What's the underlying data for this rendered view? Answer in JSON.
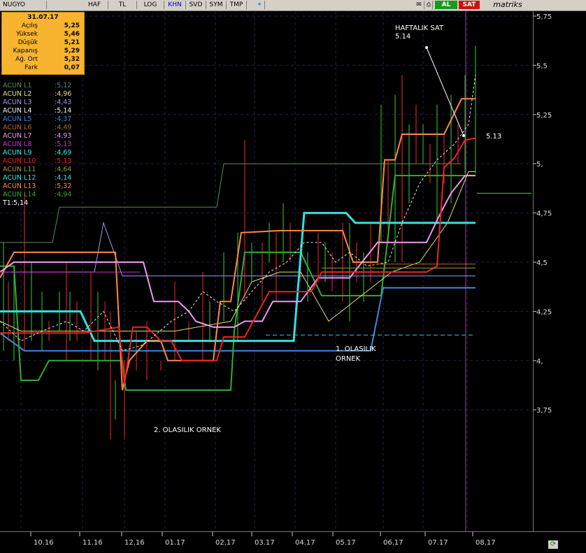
{
  "toolbar": {
    "symbol": "NUGYO",
    "tabs": [
      "HAF",
      "TL",
      "LOG",
      "KHN",
      "SVD",
      "SYM",
      "TMP"
    ],
    "buy_label": "AL",
    "sell_label": "SAT",
    "brand": "matriks"
  },
  "infobox": {
    "date": "31.07.17",
    "rows": [
      {
        "label": "Açılış",
        "value": "5,25"
      },
      {
        "label": "Yüksek",
        "value": "5,46"
      },
      {
        "label": "Düşük",
        "value": "5,21"
      },
      {
        "label": "Kapanış",
        "value": "5,29"
      },
      {
        "label": "Ağ. Ort",
        "value": "5,32"
      },
      {
        "label": "Fark",
        "value": "0,07"
      }
    ]
  },
  "chart_data": {
    "type": "line",
    "ylim": [
      3.5,
      5.8
    ],
    "y_ticks": [
      {
        "value": 5.75,
        "label": "5,75"
      },
      {
        "value": 5.5,
        "label": "5,5"
      },
      {
        "value": 5.25,
        "label": "5,25"
      },
      {
        "value": 5.0,
        "label": "5,"
      },
      {
        "value": 4.75,
        "label": "4,75"
      },
      {
        "value": 4.5,
        "label": "4,5"
      },
      {
        "value": 4.25,
        "label": "4,25"
      },
      {
        "value": 4.0,
        "label": "4,"
      },
      {
        "value": 3.75,
        "label": "3,75"
      }
    ],
    "x_ticks": [
      "10.16",
      "11.16",
      "12.16",
      "01.17",
      "02.17",
      "03.17",
      "04.17",
      "05.17",
      "06.17",
      "07.17",
      "08.17"
    ],
    "legend": [
      {
        "name": "ACUN L1",
        "value": ":5,12",
        "color": "#5a8a5a"
      },
      {
        "name": "ACUN L2",
        "value": ":4,96",
        "color": "#e0e070"
      },
      {
        "name": "ACUN L3",
        "value": ":4,43",
        "color": "#9a9aee"
      },
      {
        "name": "ACUN L4",
        "value": ":5,14",
        "color": "#f0f0f0"
      },
      {
        "name": "ACUN L5",
        "value": ":4,37",
        "color": "#3a8ae0"
      },
      {
        "name": "ACUN L6",
        "value": ":4,49",
        "color": "#b06a2a"
      },
      {
        "name": "ACUN L7",
        "value": ":4,93",
        "color": "#ee99ee"
      },
      {
        "name": "ACUN L8",
        "value": ":5,13",
        "color": "#cc33cc"
      },
      {
        "name": "ACUN L9",
        "value": ":4,69",
        "color": "#33eeee"
      },
      {
        "name": "ACUN L10",
        "value": ":5,13",
        "color": "#ee2222"
      },
      {
        "name": "ACUN L11",
        "value": ":4,64",
        "color": "#9a9a33"
      },
      {
        "name": "ACUN L12",
        "value": ":4,14",
        "color": "#33e0e0"
      },
      {
        "name": "ACUN L13",
        "value": ":5,32",
        "color": "#ff8844"
      },
      {
        "name": "ACUN L14",
        "value": ":4,94",
        "color": "#33aa33"
      }
    ],
    "t1_label": "T1:5,14",
    "annotations": {
      "weekly_sell": "HAFTALIK SAT",
      "weekly_sell_value": "5.14",
      "right_value": "5.13",
      "option1_line1": "1. OLASILIK",
      "option1_line2": "ORNEK",
      "option2": "2. OLASILIK ORNEK"
    },
    "series": [
      {
        "key": "L1",
        "color": "#5a8a5a",
        "width": 1,
        "points": [
          [
            0,
            4.6
          ],
          [
            75,
            4.6
          ],
          [
            85,
            4.78
          ],
          [
            310,
            4.78
          ],
          [
            320,
            5.0
          ],
          [
            380,
            5.0
          ],
          [
            385,
            5.0
          ],
          [
            660,
            5.0
          ]
        ]
      },
      {
        "key": "L3",
        "color": "#9a9aee",
        "width": 1,
        "points": [
          [
            0,
            4.45
          ],
          [
            135,
            4.45
          ],
          [
            148,
            4.7
          ],
          [
            175,
            4.43
          ],
          [
            680,
            4.43
          ]
        ]
      },
      {
        "key": "L5",
        "color": "#3a8ae0",
        "width": 2,
        "points": [
          [
            0,
            4.14
          ],
          [
            35,
            4.05
          ],
          [
            120,
            4.05
          ],
          [
            350,
            4.05
          ],
          [
            530,
            4.05
          ],
          [
            548,
            4.37
          ],
          [
            680,
            4.37
          ]
        ]
      },
      {
        "key": "L14",
        "color": "#33aa33",
        "width": 2,
        "points": [
          [
            0,
            4.48
          ],
          [
            20,
            4.48
          ],
          [
            30,
            3.9
          ],
          [
            55,
            3.9
          ],
          [
            70,
            4.0
          ],
          [
            175,
            4.0
          ],
          [
            180,
            3.85
          ],
          [
            330,
            3.85
          ],
          [
            335,
            4.15
          ],
          [
            350,
            4.55
          ],
          [
            430,
            4.55
          ],
          [
            460,
            4.33
          ],
          [
            500,
            4.33
          ],
          [
            545,
            4.33
          ],
          [
            565,
            4.94
          ],
          [
            680,
            4.94
          ]
        ]
      },
      {
        "key": "L2",
        "color": "#e0e070",
        "width": 1,
        "points": [
          [
            0,
            4.2
          ],
          [
            30,
            4.15
          ],
          [
            150,
            4.15
          ],
          [
            250,
            4.15
          ],
          [
            330,
            4.2
          ],
          [
            360,
            4.4
          ],
          [
            400,
            4.45
          ],
          [
            430,
            4.45
          ],
          [
            470,
            4.2
          ],
          [
            560,
            4.45
          ],
          [
            600,
            4.5
          ],
          [
            640,
            4.7
          ],
          [
            670,
            4.96
          ],
          [
            680,
            4.96
          ]
        ]
      },
      {
        "key": "L12",
        "color": "#33e0e0",
        "width": 3,
        "points": [
          [
            0,
            4.25
          ],
          [
            115,
            4.25
          ],
          [
            135,
            4.1
          ],
          [
            420,
            4.1
          ],
          [
            435,
            4.75
          ],
          [
            495,
            4.75
          ],
          [
            508,
            4.7
          ],
          [
            680,
            4.7
          ]
        ]
      },
      {
        "key": "L13",
        "color": "#ff8844",
        "width": 2,
        "points": [
          [
            0,
            4.42
          ],
          [
            20,
            4.55
          ],
          [
            165,
            4.55
          ],
          [
            175,
            3.85
          ],
          [
            185,
            4.0
          ],
          [
            210,
            4.1
          ],
          [
            230,
            4.1
          ],
          [
            240,
            4.0
          ],
          [
            305,
            4.0
          ],
          [
            315,
            4.3
          ],
          [
            330,
            4.3
          ],
          [
            345,
            4.65
          ],
          [
            400,
            4.66
          ],
          [
            490,
            4.66
          ],
          [
            505,
            4.5
          ],
          [
            540,
            4.5
          ],
          [
            550,
            5.02
          ],
          [
            565,
            5.02
          ],
          [
            575,
            5.15
          ],
          [
            635,
            5.15
          ],
          [
            660,
            5.33
          ],
          [
            680,
            5.33
          ]
        ]
      },
      {
        "key": "L7",
        "color": "#ee99ee",
        "width": 2,
        "points": [
          [
            0,
            4.45
          ],
          [
            20,
            4.5
          ],
          [
            155,
            4.5
          ],
          [
            175,
            4.5
          ],
          [
            205,
            4.5
          ],
          [
            220,
            4.3
          ],
          [
            255,
            4.3
          ],
          [
            270,
            4.25
          ],
          [
            280,
            4.2
          ],
          [
            305,
            4.17
          ],
          [
            335,
            4.17
          ],
          [
            350,
            4.2
          ],
          [
            375,
            4.2
          ],
          [
            390,
            4.3
          ],
          [
            430,
            4.3
          ],
          [
            455,
            4.42
          ],
          [
            500,
            4.42
          ],
          [
            540,
            4.6
          ],
          [
            610,
            4.6
          ],
          [
            630,
            4.75
          ],
          [
            645,
            4.85
          ],
          [
            665,
            4.94
          ],
          [
            680,
            4.94
          ]
        ]
      },
      {
        "key": "L10",
        "color": "#ee2222",
        "width": 2,
        "points": [
          [
            0,
            4.14
          ],
          [
            120,
            4.14
          ],
          [
            170,
            4.17
          ],
          [
            178,
            3.88
          ],
          [
            190,
            4.17
          ],
          [
            210,
            4.17
          ],
          [
            230,
            4.1
          ],
          [
            245,
            4.1
          ],
          [
            260,
            4.0
          ],
          [
            310,
            4.0
          ],
          [
            320,
            4.12
          ],
          [
            350,
            4.12
          ],
          [
            385,
            4.35
          ],
          [
            445,
            4.35
          ],
          [
            460,
            4.45
          ],
          [
            520,
            4.45
          ],
          [
            540,
            4.45
          ],
          [
            610,
            4.45
          ],
          [
            625,
            4.48
          ],
          [
            635,
            4.98
          ],
          [
            650,
            5.03
          ],
          [
            665,
            5.12
          ],
          [
            680,
            5.13
          ]
        ]
      },
      {
        "key": "L4",
        "color": "#f0f0f0",
        "width": 1,
        "dashed": true,
        "points": [
          [
            0,
            4.2
          ],
          [
            30,
            4.1
          ],
          [
            60,
            4.15
          ],
          [
            95,
            4.2
          ],
          [
            120,
            4.15
          ],
          [
            148,
            4.25
          ],
          [
            175,
            4.05
          ],
          [
            205,
            4.08
          ],
          [
            245,
            4.2
          ],
          [
            270,
            4.25
          ],
          [
            290,
            4.35
          ],
          [
            310,
            4.3
          ],
          [
            335,
            4.25
          ],
          [
            360,
            4.35
          ],
          [
            385,
            4.45
          ],
          [
            410,
            4.5
          ],
          [
            435,
            4.6
          ],
          [
            460,
            4.6
          ],
          [
            480,
            4.5
          ],
          [
            500,
            4.55
          ],
          [
            525,
            4.48
          ],
          [
            555,
            4.5
          ],
          [
            575,
            4.7
          ],
          [
            600,
            4.9
          ],
          [
            625,
            5.02
          ],
          [
            650,
            5.1
          ],
          [
            670,
            5.2
          ],
          [
            680,
            5.45
          ]
        ]
      },
      {
        "key": "L6",
        "color": "#b06a2a",
        "width": 1,
        "points": [
          [
            540,
            4.49
          ],
          [
            680,
            4.49
          ]
        ]
      },
      {
        "key": "L11",
        "color": "#9a9a33",
        "width": 1,
        "points": [
          [
            460,
            4.47
          ],
          [
            680,
            4.47
          ]
        ]
      },
      {
        "key": "L8",
        "color": "#cc33cc",
        "width": 1,
        "points": [
          [
            0,
            4.45
          ],
          [
            200,
            4.45
          ]
        ]
      },
      {
        "key": "T1",
        "color": "#44cc44",
        "width": 1,
        "points": [
          [
            682,
            4.85
          ],
          [
            760,
            4.85
          ]
        ]
      }
    ],
    "reference_lines": [
      {
        "color": "#33cccc",
        "dashed": true,
        "y": 4.13,
        "x0": 380,
        "x1": 680
      }
    ],
    "candles": [
      [
        5,
        4.05,
        4.6
      ],
      [
        12,
        4.1,
        4.4
      ],
      [
        20,
        4.0,
        4.45
      ],
      [
        35,
        4.05,
        4.85
      ],
      [
        45,
        4.1,
        4.5
      ],
      [
        60,
        4.05,
        4.35
      ],
      [
        70,
        4.1,
        4.2
      ],
      [
        85,
        4.15,
        4.35
      ],
      [
        95,
        4.0,
        4.5
      ],
      [
        100,
        4.1,
        4.35
      ],
      [
        110,
        4.1,
        4.3
      ],
      [
        130,
        4.0,
        4.45
      ],
      [
        140,
        3.95,
        4.35
      ],
      [
        150,
        4.0,
        4.3
      ],
      [
        158,
        3.6,
        4.25
      ],
      [
        165,
        3.7,
        3.9
      ],
      [
        178,
        3.6,
        4.0
      ],
      [
        195,
        3.95,
        4.15
      ],
      [
        210,
        3.9,
        4.2
      ],
      [
        230,
        3.95,
        4.0
      ],
      [
        250,
        4.0,
        4.4
      ],
      [
        270,
        4.1,
        4.2
      ],
      [
        290,
        4.0,
        4.45
      ],
      [
        300,
        4.1,
        4.3
      ],
      [
        320,
        4.2,
        4.55
      ],
      [
        340,
        4.1,
        4.65
      ],
      [
        350,
        4.3,
        5.12
      ],
      [
        360,
        4.4,
        4.6
      ],
      [
        375,
        4.3,
        4.6
      ],
      [
        385,
        4.5,
        4.7
      ],
      [
        395,
        4.3,
        4.65
      ],
      [
        405,
        4.5,
        4.8
      ],
      [
        415,
        4.5,
        4.7
      ],
      [
        430,
        4.4,
        4.6
      ],
      [
        440,
        4.3,
        4.55
      ],
      [
        455,
        4.4,
        4.65
      ],
      [
        465,
        4.4,
        4.6
      ],
      [
        475,
        4.35,
        4.55
      ],
      [
        490,
        4.3,
        4.7
      ],
      [
        500,
        4.2,
        4.7
      ],
      [
        510,
        4.4,
        4.6
      ],
      [
        520,
        4.3,
        4.55
      ],
      [
        530,
        4.4,
        4.7
      ],
      [
        545,
        4.6,
        5.3
      ],
      [
        555,
        4.6,
        5.02
      ],
      [
        565,
        4.5,
        5.35
      ],
      [
        575,
        4.5,
        5.45
      ],
      [
        585,
        4.8,
        5.2
      ],
      [
        595,
        5.0,
        5.3
      ],
      [
        605,
        5.0,
        5.2
      ],
      [
        615,
        4.9,
        5.1
      ],
      [
        625,
        4.7,
        5.3
      ],
      [
        635,
        4.9,
        5.15
      ],
      [
        645,
        4.8,
        5.35
      ],
      [
        655,
        5.0,
        5.2
      ],
      [
        665,
        4.95,
        5.45
      ],
      [
        680,
        4.95,
        5.6
      ]
    ]
  }
}
